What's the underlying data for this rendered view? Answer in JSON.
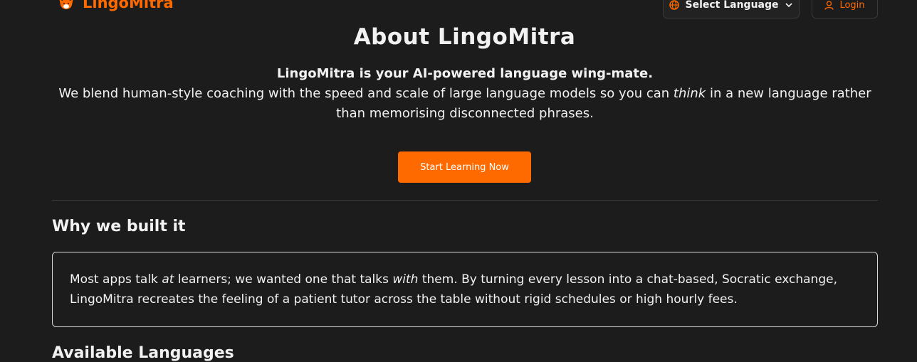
{
  "header": {
    "brand_name": "LingoMitra",
    "language_button_label": "Select Language",
    "login_label": "Login"
  },
  "hero": {
    "title": "About LingoMitra",
    "lead": "LingoMitra is your AI-powered language wing-mate.",
    "body_before": "We blend human-style coaching with the speed and scale of large language models so you can ",
    "body_emphasis": "think",
    "body_after": " in a new language rather than memorising disconnected phrases.",
    "cta_label": "Start Learning Now"
  },
  "why": {
    "heading": "Why we built it",
    "text_1": "Most apps talk ",
    "text_2": "at",
    "text_3": " learners; we wanted one that talks ",
    "text_4": "with",
    "text_5": " them. By turning every lesson into a chat-based, Socratic exchange, LingoMitra recreates the feeling of a patient tutor across the table without rigid schedules or high hourly fees."
  },
  "languages": {
    "heading": "Available Languages"
  },
  "colors": {
    "accent": "#ff6a00",
    "background": "#1c1c1c"
  },
  "icons": {
    "logo": "fox-logo",
    "language": "globe-icon",
    "dropdown": "chevron-down-icon",
    "login": "user-icon"
  }
}
